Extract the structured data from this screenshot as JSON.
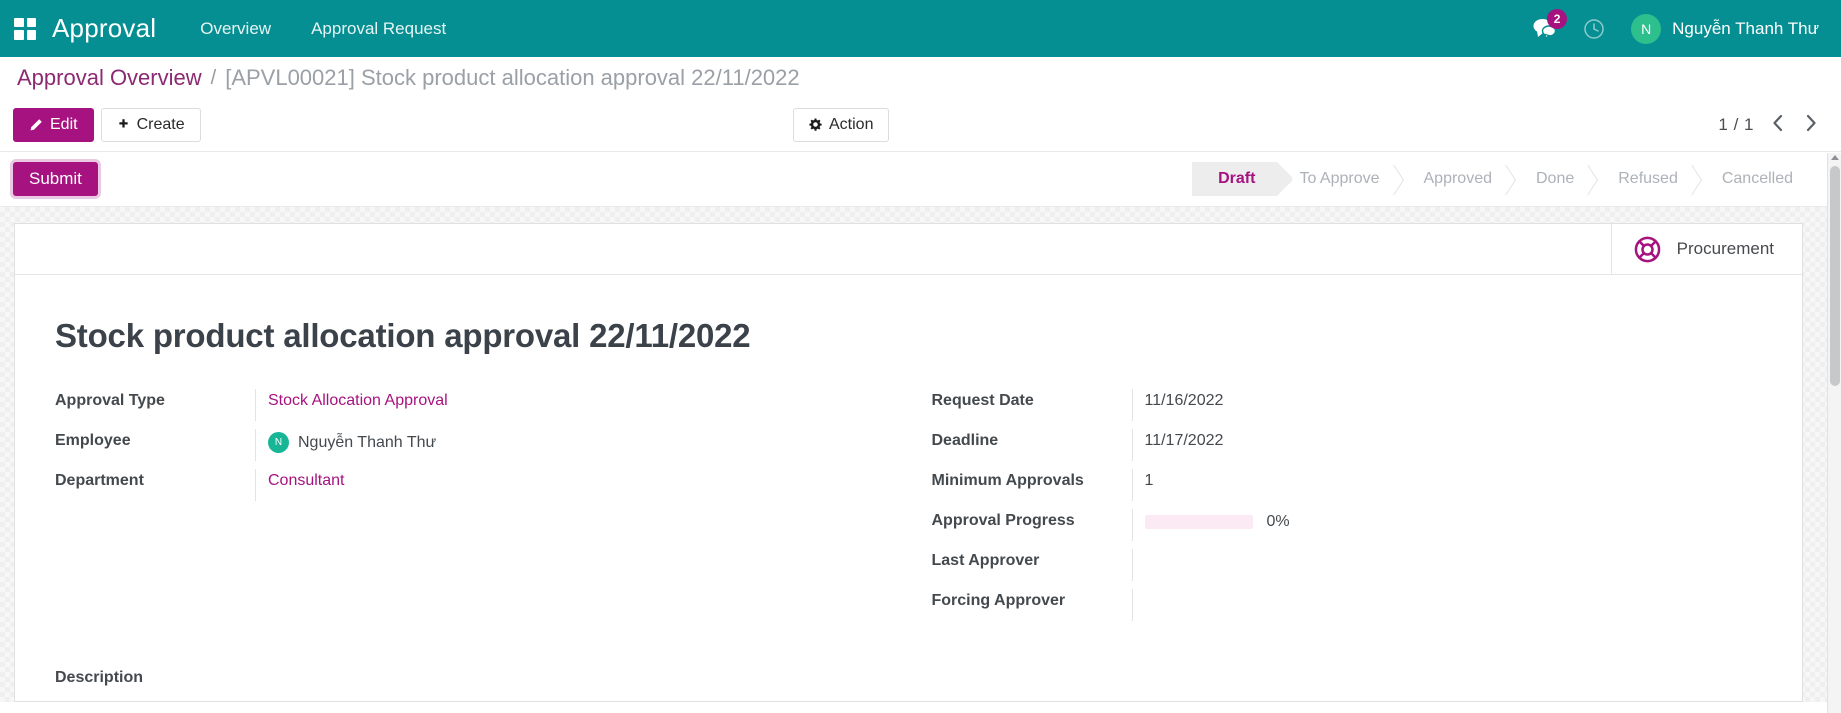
{
  "navbar": {
    "apps_icon": "grid-apps-icon",
    "brand": "Approval",
    "menu_items": [
      {
        "label": "Overview"
      },
      {
        "label": "Approval Request"
      }
    ],
    "messages_icon": "chat-bubble-icon",
    "messages_count": "2",
    "activity_icon": "clock-icon",
    "user": {
      "initial": "N",
      "name": "Nguyễn Thanh Thư",
      "avatar_color": "#2dbf8c"
    },
    "background_color": "#068f92"
  },
  "breadcrumb": {
    "root": "Approval Overview",
    "separator": "/",
    "current": "[APVL00021] Stock product allocation approval 22/11/2022"
  },
  "control_panel": {
    "edit_label": "Edit",
    "edit_icon": "pencil-icon",
    "create_label": "Create",
    "create_icon": "plus-icon",
    "action_label": "Action",
    "action_icon": "gear-icon",
    "pager": "1 / 1",
    "prev_icon": "chevron-left-icon",
    "next_icon": "chevron-right-icon"
  },
  "statusbar": {
    "submit_label": "Submit",
    "stages": [
      {
        "label": "Draft",
        "active": true
      },
      {
        "label": "To Approve",
        "active": false
      },
      {
        "label": "Approved",
        "active": false
      },
      {
        "label": "Done",
        "active": false
      },
      {
        "label": "Refused",
        "active": false
      },
      {
        "label": "Cancelled",
        "active": false
      }
    ],
    "active_color": "#a6127f"
  },
  "sheet": {
    "stat_button": {
      "icon": "lifebuoy-icon",
      "label": "Procurement"
    },
    "record_title": "Stock product allocation approval 22/11/2022",
    "left_fields": [
      {
        "label": "Approval Type",
        "value": "Stock Allocation Approval",
        "type": "many2one"
      },
      {
        "label": "Employee",
        "value": "Nguyễn Thanh Thư",
        "type": "avatar",
        "initial": "N"
      },
      {
        "label": "Department",
        "value": "Consultant",
        "type": "many2one"
      }
    ],
    "right_fields": [
      {
        "label": "Request Date",
        "value": "11/16/2022",
        "type": "text"
      },
      {
        "label": "Deadline",
        "value": "11/17/2022",
        "type": "text"
      },
      {
        "label": "Minimum Approvals",
        "value": "1",
        "type": "text"
      },
      {
        "label": "Approval Progress",
        "value": "0%",
        "type": "progress",
        "percent": 0
      },
      {
        "label": "Last Approver",
        "value": "",
        "type": "text"
      },
      {
        "label": "Forcing Approver",
        "value": "",
        "type": "text"
      }
    ],
    "description_label": "Description"
  }
}
